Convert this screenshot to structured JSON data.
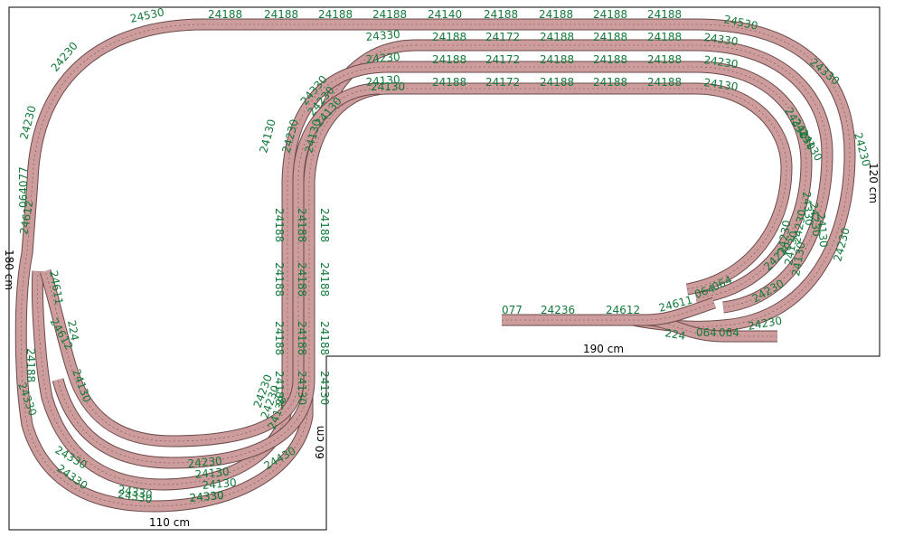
{
  "colors": {
    "track_fill": "#cd9c9c",
    "track_edge": "#6b4a4a",
    "label": "#137a3a",
    "outline": "#000000"
  },
  "dimensions": {
    "bottom_width": "110 cm",
    "right_width": "190 cm",
    "left_height": "180 cm",
    "right_height": "120 cm",
    "inner_height": "60 cm"
  },
  "track_loops": [
    {
      "name": "outer",
      "top_labels": [
        "24530",
        "24188",
        "24188",
        "24188",
        "24188",
        "24188",
        "24188",
        "24188",
        "24188",
        "24530"
      ],
      "curve_labels": [
        "24230",
        "24230",
        "24330",
        "24330",
        "24330",
        "24430",
        "24330",
        "24230",
        "24230"
      ],
      "left_labels": [
        "064077",
        "24612",
        "24188",
        "24330",
        "24330",
        "24330",
        "24330"
      ]
    },
    {
      "name": "loop2",
      "top_labels": [
        "24330",
        "24188",
        "24172",
        "24188",
        "24188",
        "24188",
        "24330"
      ],
      "curve_labels": [
        "24330",
        "24330",
        "24330",
        "24230",
        "24230",
        "24230"
      ],
      "side_labels": [
        "24130",
        "24188",
        "24188",
        "24188",
        "24188"
      ]
    },
    {
      "name": "loop3",
      "top_labels": [
        "24230",
        "24188",
        "24172",
        "24188",
        "24188",
        "24188",
        "24230"
      ],
      "curve_labels": [
        "24230",
        "24230",
        "24230",
        "24130",
        "24230",
        "24130",
        "24130"
      ],
      "side_labels": [
        "24230",
        "24188",
        "24188",
        "24188",
        "24130"
      ]
    },
    {
      "name": "inner",
      "top_labels": [
        "24130",
        "24188",
        "24172",
        "24188",
        "24188",
        "24188",
        "24130"
      ],
      "curve_labels": [
        "24130",
        "24130",
        "24130",
        "24130",
        "24130",
        "24130",
        "24130"
      ],
      "side_labels": [
        "24130",
        "24188",
        "24188",
        "24188",
        "24130"
      ]
    }
  ],
  "siding_labels": [
    "077",
    "24236",
    "24612",
    "24611",
    "064",
    "064",
    "224",
    "064",
    "064",
    "24230"
  ],
  "left_switch_labels": [
    "24611",
    "224",
    "24612",
    "24130"
  ],
  "misc_labels": [
    "24140",
    "24130",
    "24230",
    "24230",
    "24230"
  ]
}
